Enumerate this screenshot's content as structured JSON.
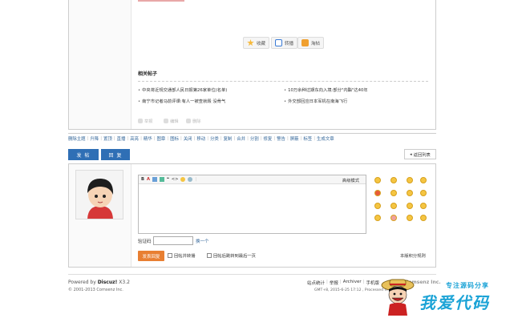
{
  "post_actions": {
    "favorite": "收藏",
    "share": "转播",
    "sharing": "淘帖"
  },
  "related": {
    "title": "相关帖子",
    "items": [
      "中央将近规交通部人民日报第26家单位(名单)",
      "10万余种过期东向入境:部分\"内酯\"达40年",
      "南宁市记者马前评课:有人一被查就毁 没骨气",
      "外交部回应日本军机在南海飞行"
    ]
  },
  "post_footer": {
    "report": "举报",
    "edit": "编辑",
    "delete": "删除"
  },
  "mod_tools": [
    "删除主题",
    "升降",
    "置顶",
    "直播",
    "高亮",
    "精华",
    "图章",
    "图标",
    "关闭",
    "移动",
    "分类",
    "复制",
    "合并",
    "分割",
    "修复",
    "警告",
    "屏蔽",
    "标签",
    "生成文章"
  ],
  "tabs": {
    "post": "发 帖",
    "reply": "回 复"
  },
  "back_to_list": "返回列表",
  "editor": {
    "advanced_mode": "高级模式",
    "toolbar_bold": "B",
    "toolbar_color": "A",
    "toolbar_quote": "❝",
    "toolbar_code": "<>"
  },
  "captcha": {
    "label": "验证码",
    "change": "换一个",
    "value": ""
  },
  "submit_label": "发表回复",
  "options": {
    "reply_and_share": "回帖并转播",
    "jump_after_reply": "回帖后跳转到最后一页"
  },
  "credit_rules": "本版积分规则",
  "footer": {
    "powered_prefix": "Powered by ",
    "powered_name": "Discuz!",
    "powered_version": " X3.2",
    "copyright": "© 2001-2013 Comsenz Inc.",
    "links": [
      "站点统计",
      "举报",
      "Archiver",
      "手机版"
    ],
    "gmt": "GMT+8, 2015-6-25 17:12 , Processed in"
  },
  "watermark": {
    "sub": "专注源码分享",
    "main": "我爱代码",
    "ghost": "Comsenz Inc."
  },
  "colors": {
    "accent_blue": "#2f6fb5",
    "submit_orange": "#e87f32",
    "link_blue": "#336699",
    "watermark_blue": "#1ba3d6"
  }
}
